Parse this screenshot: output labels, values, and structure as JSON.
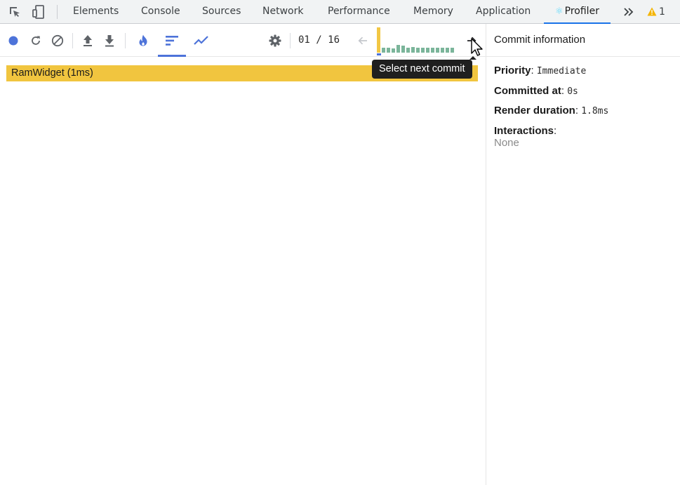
{
  "devtools": {
    "tabs": [
      {
        "label": "Elements"
      },
      {
        "label": "Console"
      },
      {
        "label": "Sources"
      },
      {
        "label": "Network"
      },
      {
        "label": "Performance"
      },
      {
        "label": "Memory"
      },
      {
        "label": "Application"
      },
      {
        "label": "Profiler",
        "active": true
      }
    ],
    "profiler_glyph": "⚛",
    "warning_count": "1",
    "icons": [
      "inspect-element-icon",
      "device-toolbar-icon",
      "more-tabs-chevron-icon",
      "warning-icon"
    ]
  },
  "toolbar": {
    "icons": [
      "record-icon",
      "reload-and-profile-icon",
      "clear-icon",
      "load-profile-icon",
      "save-profile-icon",
      "flamegraph-icon",
      "ranked-chart-icon",
      "interactions-icon",
      "settings-gear-icon",
      "previous-commit-arrow-icon",
      "next-commit-arrow-icon"
    ],
    "commit_counter": "01 / 16",
    "selected_view": "ranked",
    "commits": {
      "count": 16,
      "selected_index": 0,
      "relative_durations": [
        1.0,
        0.2,
        0.2,
        0.17,
        0.3,
        0.27,
        0.2,
        0.22,
        0.2,
        0.2,
        0.2,
        0.2,
        0.2,
        0.2,
        0.2,
        0.2
      ]
    }
  },
  "chart": {
    "rows": [
      {
        "label": "RamWidget (1ms)"
      }
    ]
  },
  "tooltip": {
    "text": "Select next commit"
  },
  "sidebar": {
    "title": "Commit information",
    "priority_label": "Priority",
    "priority_value": "Immediate",
    "committed_at_label": "Committed at",
    "committed_at_value": "0s",
    "render_duration_label": "Render duration",
    "render_duration_value": "1.8ms",
    "interactions_label": "Interactions",
    "interactions_value": "None",
    "separator": ":"
  },
  "colors": {
    "accent": "#4d73d9",
    "tab_underline": "#1a73e8",
    "selected_commit": "#f2c744",
    "commit_bar": "#7bb59a",
    "flame_bar": "#f1c53f",
    "warning": "#f4b400"
  }
}
